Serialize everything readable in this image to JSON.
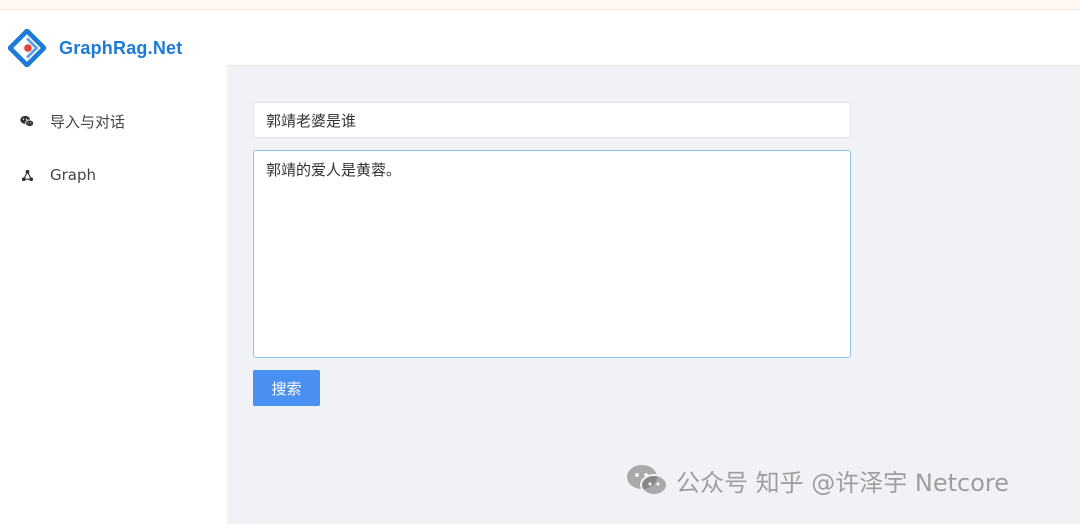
{
  "app": {
    "brand_title": "GraphRag.Net",
    "colors": {
      "brand": "#1e7ad8",
      "logo_red": "#e8403a",
      "primary_button": "#4a90f0"
    }
  },
  "sidebar": {
    "items": [
      {
        "label": "导入与对话",
        "icon": "wechat-icon"
      },
      {
        "label": "Graph",
        "icon": "graph-icon"
      }
    ]
  },
  "main": {
    "query_value": "郭靖老婆是谁",
    "answer_value": "郭靖的爱人是黄蓉。",
    "search_label": "搜索"
  },
  "watermark": {
    "text": "公众号 知乎 @许泽宇 Netcore",
    "icon": "wechat-icon"
  }
}
